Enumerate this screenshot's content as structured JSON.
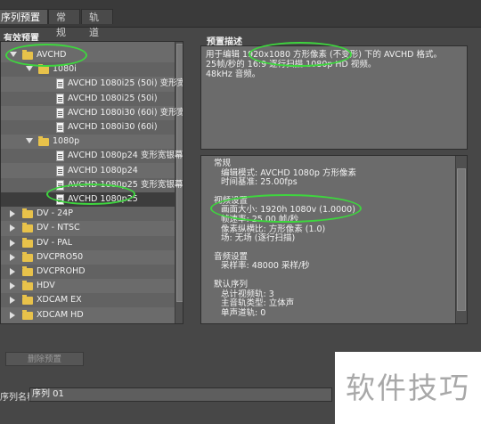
{
  "tabs": [
    {
      "label": "序列预置"
    },
    {
      "label": "常规"
    },
    {
      "label": "轨道"
    }
  ],
  "presets_panel": {
    "title": "有效预置"
  },
  "tree": [
    {
      "label": "AVCHD",
      "type": "folder",
      "level": 0,
      "expanded": true
    },
    {
      "label": "1080i",
      "type": "folder",
      "level": 1,
      "expanded": true
    },
    {
      "label": "AVCHD  1080i25 (50i) 变形宽",
      "type": "file",
      "level": 2
    },
    {
      "label": "AVCHD  1080i25 (50i)",
      "type": "file",
      "level": 2
    },
    {
      "label": "AVCHD  1080i30 (60i) 变形宽",
      "type": "file",
      "level": 2
    },
    {
      "label": "AVCHD  1080i30 (60i)",
      "type": "file",
      "level": 2
    },
    {
      "label": "1080p",
      "type": "folder",
      "level": 1,
      "expanded": true
    },
    {
      "label": "AVCHD  1080p24 变形宽银幕",
      "type": "file",
      "level": 2
    },
    {
      "label": "AVCHD  1080p24",
      "type": "file",
      "level": 2
    },
    {
      "label": "AVCHD  1080p25 变形宽银幕",
      "type": "file",
      "level": 2
    },
    {
      "label": "AVCHD 1080p25",
      "type": "file",
      "level": 2,
      "selected": true
    },
    {
      "label": "DV - 24P",
      "type": "folder",
      "level": 0,
      "expanded": false
    },
    {
      "label": "DV - NTSC",
      "type": "folder",
      "level": 0,
      "expanded": false
    },
    {
      "label": "DV - PAL",
      "type": "folder",
      "level": 0,
      "expanded": false
    },
    {
      "label": "DVCPRO50",
      "type": "folder",
      "level": 0,
      "expanded": false
    },
    {
      "label": "DVCPROHD",
      "type": "folder",
      "level": 0,
      "expanded": false
    },
    {
      "label": "HDV",
      "type": "folder",
      "level": 0,
      "expanded": false
    },
    {
      "label": "XDCAM EX",
      "type": "folder",
      "level": 0,
      "expanded": false
    },
    {
      "label": "XDCAM HD",
      "type": "folder",
      "level": 0,
      "expanded": false
    }
  ],
  "description_panel": {
    "title": "预置描述",
    "lines": [
      "用于编辑 1920x1080 方形像素 (不变形) 下的 AVCHD 格式。",
      "25帧/秒的 16:9 逐行扫描 1080p HD 视频。",
      "48kHz 音频。"
    ]
  },
  "details": {
    "general_heading": "常规",
    "general": [
      "编辑模式: AVCHD 1080p 方形像素",
      "时间基准: 25.00fps"
    ],
    "video_heading": "视频设置",
    "video": [
      "画面大小: 1920h 1080v (1.0000)",
      "帧速率: 25.00 帧/秒",
      "像素纵横比: 方形像素 (1.0)",
      "场: 无场 (逐行扫描)"
    ],
    "audio_heading": "音频设置",
    "audio": [
      "采样率: 48000 采样/秒"
    ],
    "seq_heading": "默认序列",
    "seq": [
      "总计视频轨: 3",
      "主音轨类型: 立体声",
      "单声道轨: 0"
    ]
  },
  "delete_button": "删除预置",
  "sequence_name": {
    "label": "序列名称:",
    "value": "序列 01"
  },
  "watermark": "软件技巧",
  "colors": {
    "annotation": "#3ed63e",
    "folder": "#e8c24a",
    "panel": "#6b6b6b"
  }
}
